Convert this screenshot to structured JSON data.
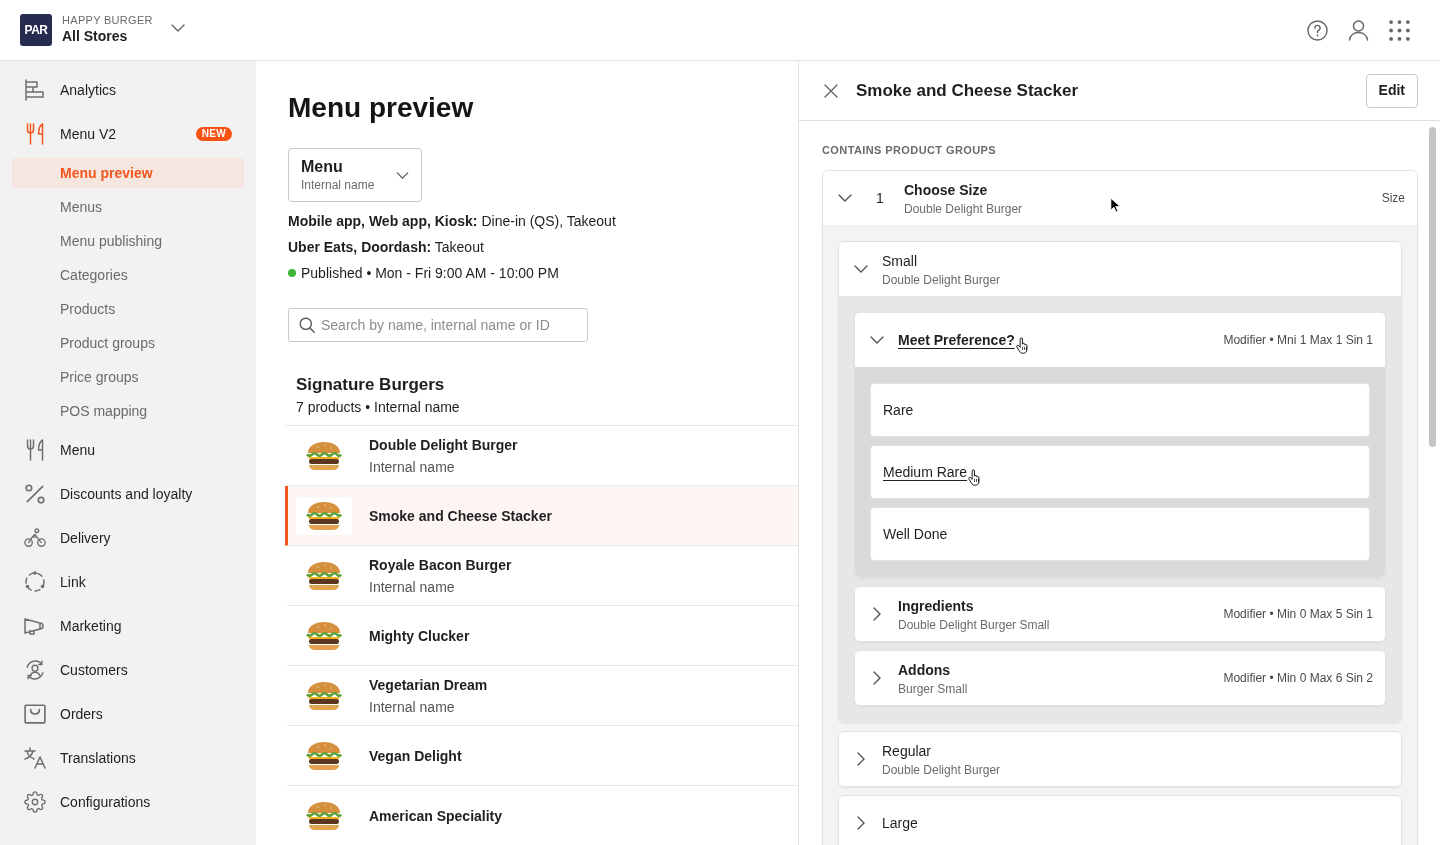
{
  "topbar": {
    "logo": "PAR",
    "brand": "HAPPY BURGER",
    "store": "All Stores"
  },
  "sidebar": {
    "items": [
      {
        "label": "Analytics",
        "selected": false
      },
      {
        "label": "Menu V2",
        "selected": true,
        "badge": "NEW",
        "children": [
          {
            "label": "Menu preview",
            "selected": true
          },
          {
            "label": "Menus",
            "selected": false
          },
          {
            "label": "Menu publishing",
            "selected": false
          },
          {
            "label": "Categories",
            "selected": false
          },
          {
            "label": "Products",
            "selected": false
          },
          {
            "label": "Product groups",
            "selected": false
          },
          {
            "label": "Price groups",
            "selected": false
          },
          {
            "label": "POS mapping",
            "selected": false
          }
        ]
      },
      {
        "label": "Menu",
        "selected": false
      },
      {
        "label": "Discounts and loyalty",
        "selected": false
      },
      {
        "label": "Delivery",
        "selected": false
      },
      {
        "label": "Link",
        "selected": false
      },
      {
        "label": "Marketing",
        "selected": false
      },
      {
        "label": "Customers",
        "selected": false
      },
      {
        "label": "Orders",
        "selected": false
      },
      {
        "label": "Translations",
        "selected": false
      },
      {
        "label": "Configurations",
        "selected": false
      }
    ]
  },
  "page": {
    "title": "Menu preview",
    "menu_select": {
      "value": "Menu",
      "caption": "Internal name"
    },
    "channels": [
      "**Mobile app, Web app, Kiosk:** Dine-in (QS), Takeout",
      "**Uber Eats, Doordash:** Takeout"
    ],
    "status": {
      "text": "Published • Mon - Fri 9:00 AM - 10:00 PM",
      "color": "#3db33a"
    },
    "search": {
      "placeholder": "Search by name, internal name or ID"
    },
    "category": {
      "title": "Signature Burgers",
      "subtitle": "7 products • Internal name"
    },
    "products": [
      {
        "name": "Double Delight Burger",
        "internal_name": "Internal name",
        "selected": false
      },
      {
        "name": "Smoke and Cheese Stacker",
        "selected": true
      },
      {
        "name": "Royale Bacon Burger",
        "internal_name": "Internal name",
        "selected": false
      },
      {
        "name": "Mighty Clucker",
        "selected": false
      },
      {
        "name": "Vegetarian Dream",
        "internal_name": "Internal name",
        "selected": false
      },
      {
        "name": "Vegan Delight",
        "selected": false
      },
      {
        "name": "American Speciality",
        "selected": false
      }
    ]
  },
  "detail": {
    "title": "Smoke and Cheese Stacker",
    "edit": "Edit",
    "section_label": "CONTAINS PRODUCT GROUPS",
    "groups": [
      {
        "index": "1",
        "name": "Choose Size",
        "product": "Double Delight Burger",
        "info": "Size",
        "expanded": true,
        "children": [
          {
            "name": "Small",
            "product": "Double Delight Burger",
            "expanded": true,
            "children": [
              {
                "name": "Meet Preference?",
                "info": "Modifier • Mni 1 Max 1 Sin 1",
                "expanded": true,
                "hovered": true,
                "children": [
                  {
                    "name": "Rare",
                    "hovered": false
                  },
                  {
                    "name": "Medium Rare",
                    "hovered": true
                  },
                  {
                    "name": "Well Done",
                    "hovered": false
                  }
                ]
              },
              {
                "name": "Ingredients",
                "product": "Double Delight Burger Small",
                "info": "Modifier • Min 0 Max 5 Sin 1",
                "expanded": false,
                "hovered": false
              },
              {
                "name": "Addons",
                "product": "Burger Small",
                "info": "Modifier • Min 0 Max 6 Sin 2",
                "expanded": false,
                "hovered": false
              }
            ]
          },
          {
            "name": "Regular",
            "product": "Double Delight Burger",
            "expanded": false
          },
          {
            "name": "Large",
            "expanded": false
          }
        ]
      }
    ]
  }
}
